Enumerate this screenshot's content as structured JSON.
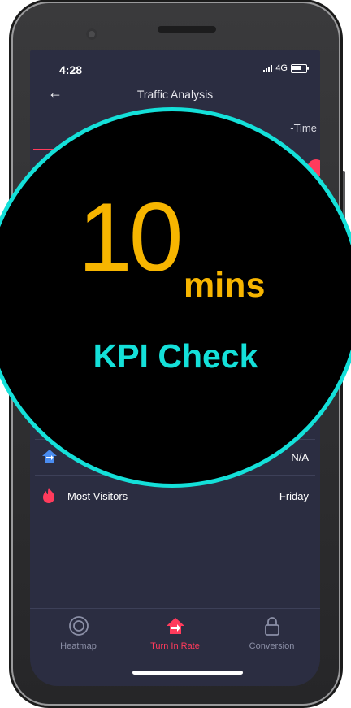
{
  "status": {
    "time": "4:28",
    "network": "4G"
  },
  "header": {
    "title": "Traffic Analysis"
  },
  "tabs": {
    "left_partial": "T",
    "right_partial": "-Time"
  },
  "rows": [
    {
      "label": "",
      "value": "N/A"
    },
    {
      "label": "Most Visitors",
      "value": "Friday"
    }
  ],
  "overlay": {
    "number": "10",
    "unit": "mins",
    "caption": "KPI Check"
  },
  "bottom_nav": [
    {
      "label": "Heatmap",
      "icon": "target-icon"
    },
    {
      "label": "Turn In Rate",
      "icon": "house-enter-icon"
    },
    {
      "label": "Conversion",
      "icon": "lock-icon"
    }
  ],
  "colors": {
    "accent": "#ff3b5c",
    "badge_border": "#14e0d9",
    "number": "#f7b500",
    "screen_bg": "#2b2d41"
  }
}
